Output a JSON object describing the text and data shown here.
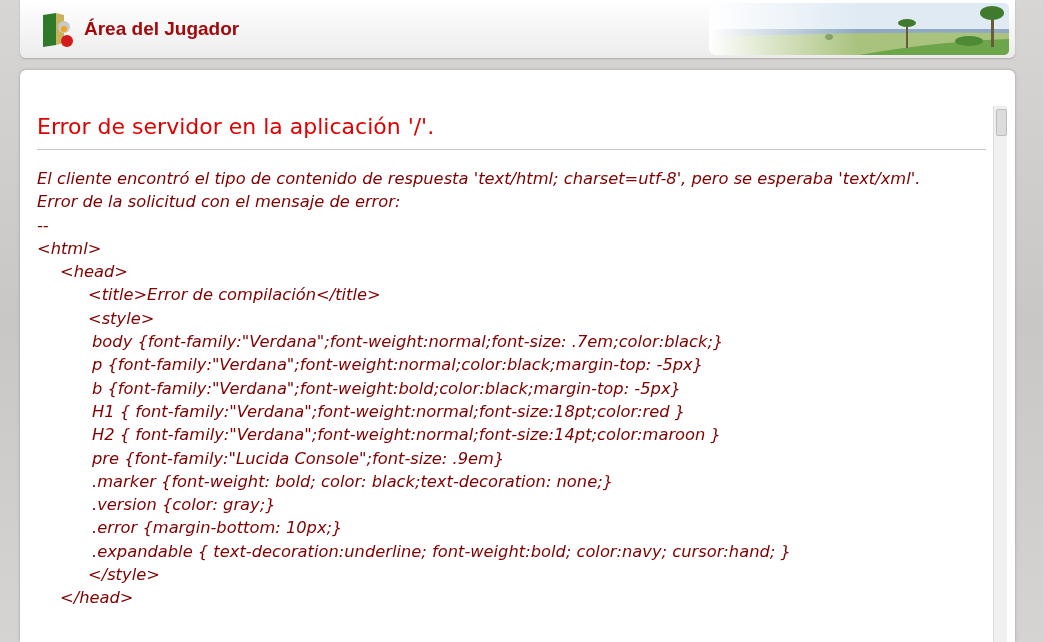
{
  "header": {
    "title": "Área del Jugador"
  },
  "error": {
    "heading": "Error de servidor en la aplicación '/'.",
    "message": [
      "El cliente encontró el tipo de contenido de respuesta 'text/html; charset=utf-8', pero se esperaba 'text/xml'.",
      "Error de la solicitud con el mensaje de error:",
      "--"
    ],
    "code": [
      {
        "text": "<html>",
        "children": [
          {
            "text": "<head>",
            "children": [
              {
                "text": "<title>Error de compilación</title>"
              },
              {
                "text": "<style>",
                "children": [
                  {
                    "text": "body {font-family:\"Verdana\";font-weight:normal;font-size: .7em;color:black;}"
                  },
                  {
                    "text": "p {font-family:\"Verdana\";font-weight:normal;color:black;margin-top: -5px}"
                  },
                  {
                    "text": "b {font-family:\"Verdana\";font-weight:bold;color:black;margin-top: -5px}"
                  },
                  {
                    "text": "H1 { font-family:\"Verdana\";font-weight:normal;font-size:18pt;color:red }"
                  },
                  {
                    "text": "H2 { font-family:\"Verdana\";font-weight:normal;font-size:14pt;color:maroon }"
                  },
                  {
                    "text": "pre {font-family:\"Lucida Console\";font-size: .9em}"
                  },
                  {
                    "text": ".marker {font-weight: bold; color: black;text-decoration: none;}"
                  },
                  {
                    "text": ".version {color: gray;}"
                  },
                  {
                    "text": ".error {margin-bottom: 10px;}"
                  },
                  {
                    "text": ".expandable { text-decoration:underline; font-weight:bold; color:navy; cursor:hand; }"
                  }
                ]
              },
              {
                "text": "</style>"
              }
            ]
          },
          {
            "text": "</head>"
          }
        ]
      }
    ]
  }
}
